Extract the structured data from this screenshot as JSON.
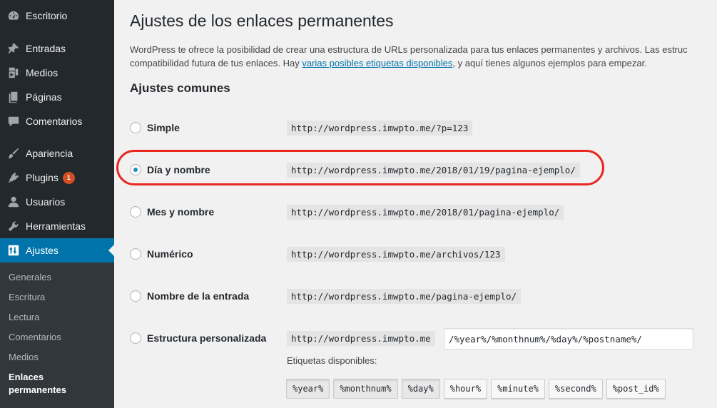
{
  "sidebar": {
    "items": [
      {
        "label": "Escritorio",
        "icon": "dashboard-icon"
      },
      {
        "label": "Entradas",
        "icon": "pushpin-icon"
      },
      {
        "label": "Medios",
        "icon": "media-icon"
      },
      {
        "label": "Páginas",
        "icon": "page-icon"
      },
      {
        "label": "Comentarios",
        "icon": "comment-icon"
      },
      {
        "label": "Apariencia",
        "icon": "paintbrush-icon"
      },
      {
        "label": "Plugins",
        "icon": "plugin-icon",
        "badge": "1"
      },
      {
        "label": "Usuarios",
        "icon": "user-icon"
      },
      {
        "label": "Herramientas",
        "icon": "wrench-icon"
      },
      {
        "label": "Ajustes",
        "icon": "settings-icon",
        "active": true
      }
    ],
    "submenu": [
      "Generales",
      "Escritura",
      "Lectura",
      "Comentarios",
      "Medios",
      "Enlaces permanentes"
    ]
  },
  "page": {
    "title": "Ajustes de los enlaces permanentes",
    "desc_part1": "WordPress te ofrece la posibilidad de crear una estructura de URLs personalizada para tus enlaces permanentes y archivos. Las estruc",
    "desc_part2": "compatibilidad futura de tus enlaces. Hay ",
    "desc_link": "varias posibles etiquetas disponibles",
    "desc_part3": ", y aquí tienes algunos ejemplos para empezar.",
    "section_title": "Ajustes comunes"
  },
  "options": [
    {
      "label": "Simple",
      "url": "http://wordpress.imwpto.me/?p=123",
      "checked": false
    },
    {
      "label": "Día y nombre",
      "url": "http://wordpress.imwpto.me/2018/01/19/pagina-ejemplo/",
      "checked": true
    },
    {
      "label": "Mes y nombre",
      "url": "http://wordpress.imwpto.me/2018/01/pagina-ejemplo/",
      "checked": false
    },
    {
      "label": "Numérico",
      "url": "http://wordpress.imwpto.me/archivos/123",
      "checked": false
    },
    {
      "label": "Nombre de la entrada",
      "url": "http://wordpress.imwpto.me/pagina-ejemplo/",
      "checked": false
    },
    {
      "label": "Estructura personalizada",
      "url": "http://wordpress.imwpto.me",
      "checked": false
    }
  ],
  "custom": {
    "value": "/%year%/%monthnum%/%day%/%postname%/",
    "tags_label": "Etiquetas disponibles:",
    "tags": [
      "%year%",
      "%monthnum%",
      "%day%",
      "%hour%",
      "%minute%",
      "%second%",
      "%post_id%"
    ],
    "pressed_tags": [
      "%year%",
      "%monthnum%",
      "%day%"
    ]
  },
  "colors": {
    "accent": "#0073aa",
    "highlight": "#e8271e",
    "sidebar_bg": "#23282d"
  }
}
